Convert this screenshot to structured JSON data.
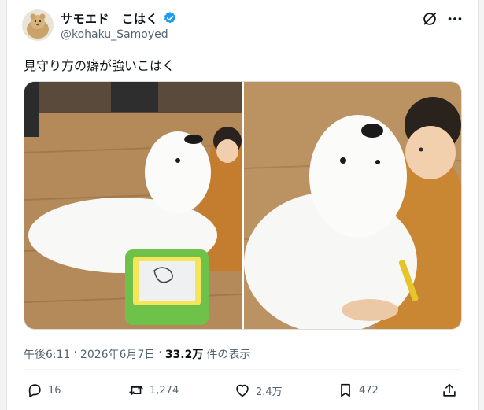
{
  "post": {
    "author": {
      "display_name": "サモエド　こはく",
      "handle": "@kohaku_Samoyed",
      "verified": true
    },
    "text": "見守り方の癖が強いこはく",
    "meta": {
      "time": "午後6:11",
      "separator1": "·",
      "date": "2026年6月7日",
      "separator2": "·",
      "views_count": "33.2万",
      "views_label": "件の表示"
    },
    "actions": {
      "replies": "16",
      "reposts": "1,274",
      "likes": "2.4万",
      "bookmarks": "472"
    }
  },
  "icons": [
    "grok-icon",
    "more-icon",
    "reply-icon",
    "repost-icon",
    "like-icon",
    "bookmark-icon",
    "share-icon",
    "verified-badge-icon"
  ],
  "colors": {
    "text_primary": "#0f1419",
    "text_secondary": "#536471",
    "verified_blue": "#1d9bf0",
    "divider": "#eff3f4"
  }
}
